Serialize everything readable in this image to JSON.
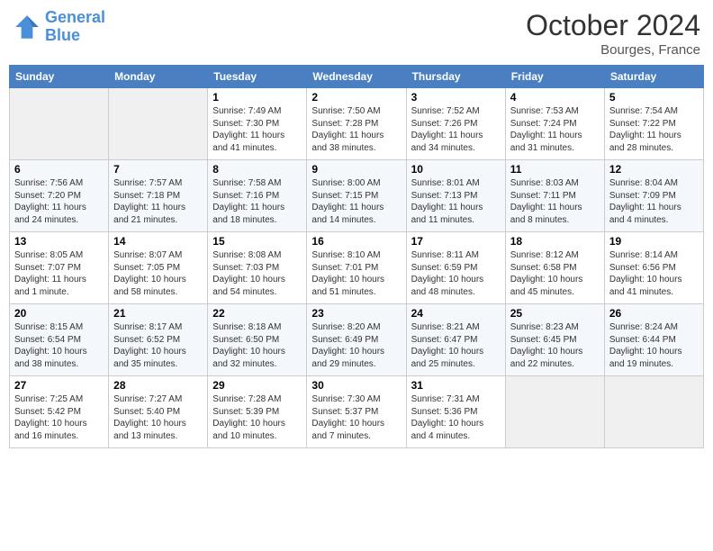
{
  "header": {
    "logo_line1": "General",
    "logo_line2": "Blue",
    "month": "October 2024",
    "location": "Bourges, France"
  },
  "weekdays": [
    "Sunday",
    "Monday",
    "Tuesday",
    "Wednesday",
    "Thursday",
    "Friday",
    "Saturday"
  ],
  "weeks": [
    [
      {
        "day": null
      },
      {
        "day": null
      },
      {
        "day": "1",
        "sunrise": "Sunrise: 7:49 AM",
        "sunset": "Sunset: 7:30 PM",
        "daylight": "Daylight: 11 hours and 41 minutes."
      },
      {
        "day": "2",
        "sunrise": "Sunrise: 7:50 AM",
        "sunset": "Sunset: 7:28 PM",
        "daylight": "Daylight: 11 hours and 38 minutes."
      },
      {
        "day": "3",
        "sunrise": "Sunrise: 7:52 AM",
        "sunset": "Sunset: 7:26 PM",
        "daylight": "Daylight: 11 hours and 34 minutes."
      },
      {
        "day": "4",
        "sunrise": "Sunrise: 7:53 AM",
        "sunset": "Sunset: 7:24 PM",
        "daylight": "Daylight: 11 hours and 31 minutes."
      },
      {
        "day": "5",
        "sunrise": "Sunrise: 7:54 AM",
        "sunset": "Sunset: 7:22 PM",
        "daylight": "Daylight: 11 hours and 28 minutes."
      }
    ],
    [
      {
        "day": "6",
        "sunrise": "Sunrise: 7:56 AM",
        "sunset": "Sunset: 7:20 PM",
        "daylight": "Daylight: 11 hours and 24 minutes."
      },
      {
        "day": "7",
        "sunrise": "Sunrise: 7:57 AM",
        "sunset": "Sunset: 7:18 PM",
        "daylight": "Daylight: 11 hours and 21 minutes."
      },
      {
        "day": "8",
        "sunrise": "Sunrise: 7:58 AM",
        "sunset": "Sunset: 7:16 PM",
        "daylight": "Daylight: 11 hours and 18 minutes."
      },
      {
        "day": "9",
        "sunrise": "Sunrise: 8:00 AM",
        "sunset": "Sunset: 7:15 PM",
        "daylight": "Daylight: 11 hours and 14 minutes."
      },
      {
        "day": "10",
        "sunrise": "Sunrise: 8:01 AM",
        "sunset": "Sunset: 7:13 PM",
        "daylight": "Daylight: 11 hours and 11 minutes."
      },
      {
        "day": "11",
        "sunrise": "Sunrise: 8:03 AM",
        "sunset": "Sunset: 7:11 PM",
        "daylight": "Daylight: 11 hours and 8 minutes."
      },
      {
        "day": "12",
        "sunrise": "Sunrise: 8:04 AM",
        "sunset": "Sunset: 7:09 PM",
        "daylight": "Daylight: 11 hours and 4 minutes."
      }
    ],
    [
      {
        "day": "13",
        "sunrise": "Sunrise: 8:05 AM",
        "sunset": "Sunset: 7:07 PM",
        "daylight": "Daylight: 11 hours and 1 minute."
      },
      {
        "day": "14",
        "sunrise": "Sunrise: 8:07 AM",
        "sunset": "Sunset: 7:05 PM",
        "daylight": "Daylight: 10 hours and 58 minutes."
      },
      {
        "day": "15",
        "sunrise": "Sunrise: 8:08 AM",
        "sunset": "Sunset: 7:03 PM",
        "daylight": "Daylight: 10 hours and 54 minutes."
      },
      {
        "day": "16",
        "sunrise": "Sunrise: 8:10 AM",
        "sunset": "Sunset: 7:01 PM",
        "daylight": "Daylight: 10 hours and 51 minutes."
      },
      {
        "day": "17",
        "sunrise": "Sunrise: 8:11 AM",
        "sunset": "Sunset: 6:59 PM",
        "daylight": "Daylight: 10 hours and 48 minutes."
      },
      {
        "day": "18",
        "sunrise": "Sunrise: 8:12 AM",
        "sunset": "Sunset: 6:58 PM",
        "daylight": "Daylight: 10 hours and 45 minutes."
      },
      {
        "day": "19",
        "sunrise": "Sunrise: 8:14 AM",
        "sunset": "Sunset: 6:56 PM",
        "daylight": "Daylight: 10 hours and 41 minutes."
      }
    ],
    [
      {
        "day": "20",
        "sunrise": "Sunrise: 8:15 AM",
        "sunset": "Sunset: 6:54 PM",
        "daylight": "Daylight: 10 hours and 38 minutes."
      },
      {
        "day": "21",
        "sunrise": "Sunrise: 8:17 AM",
        "sunset": "Sunset: 6:52 PM",
        "daylight": "Daylight: 10 hours and 35 minutes."
      },
      {
        "day": "22",
        "sunrise": "Sunrise: 8:18 AM",
        "sunset": "Sunset: 6:50 PM",
        "daylight": "Daylight: 10 hours and 32 minutes."
      },
      {
        "day": "23",
        "sunrise": "Sunrise: 8:20 AM",
        "sunset": "Sunset: 6:49 PM",
        "daylight": "Daylight: 10 hours and 29 minutes."
      },
      {
        "day": "24",
        "sunrise": "Sunrise: 8:21 AM",
        "sunset": "Sunset: 6:47 PM",
        "daylight": "Daylight: 10 hours and 25 minutes."
      },
      {
        "day": "25",
        "sunrise": "Sunrise: 8:23 AM",
        "sunset": "Sunset: 6:45 PM",
        "daylight": "Daylight: 10 hours and 22 minutes."
      },
      {
        "day": "26",
        "sunrise": "Sunrise: 8:24 AM",
        "sunset": "Sunset: 6:44 PM",
        "daylight": "Daylight: 10 hours and 19 minutes."
      }
    ],
    [
      {
        "day": "27",
        "sunrise": "Sunrise: 7:25 AM",
        "sunset": "Sunset: 5:42 PM",
        "daylight": "Daylight: 10 hours and 16 minutes."
      },
      {
        "day": "28",
        "sunrise": "Sunrise: 7:27 AM",
        "sunset": "Sunset: 5:40 PM",
        "daylight": "Daylight: 10 hours and 13 minutes."
      },
      {
        "day": "29",
        "sunrise": "Sunrise: 7:28 AM",
        "sunset": "Sunset: 5:39 PM",
        "daylight": "Daylight: 10 hours and 10 minutes."
      },
      {
        "day": "30",
        "sunrise": "Sunrise: 7:30 AM",
        "sunset": "Sunset: 5:37 PM",
        "daylight": "Daylight: 10 hours and 7 minutes."
      },
      {
        "day": "31",
        "sunrise": "Sunrise: 7:31 AM",
        "sunset": "Sunset: 5:36 PM",
        "daylight": "Daylight: 10 hours and 4 minutes."
      },
      {
        "day": null
      },
      {
        "day": null
      }
    ]
  ]
}
